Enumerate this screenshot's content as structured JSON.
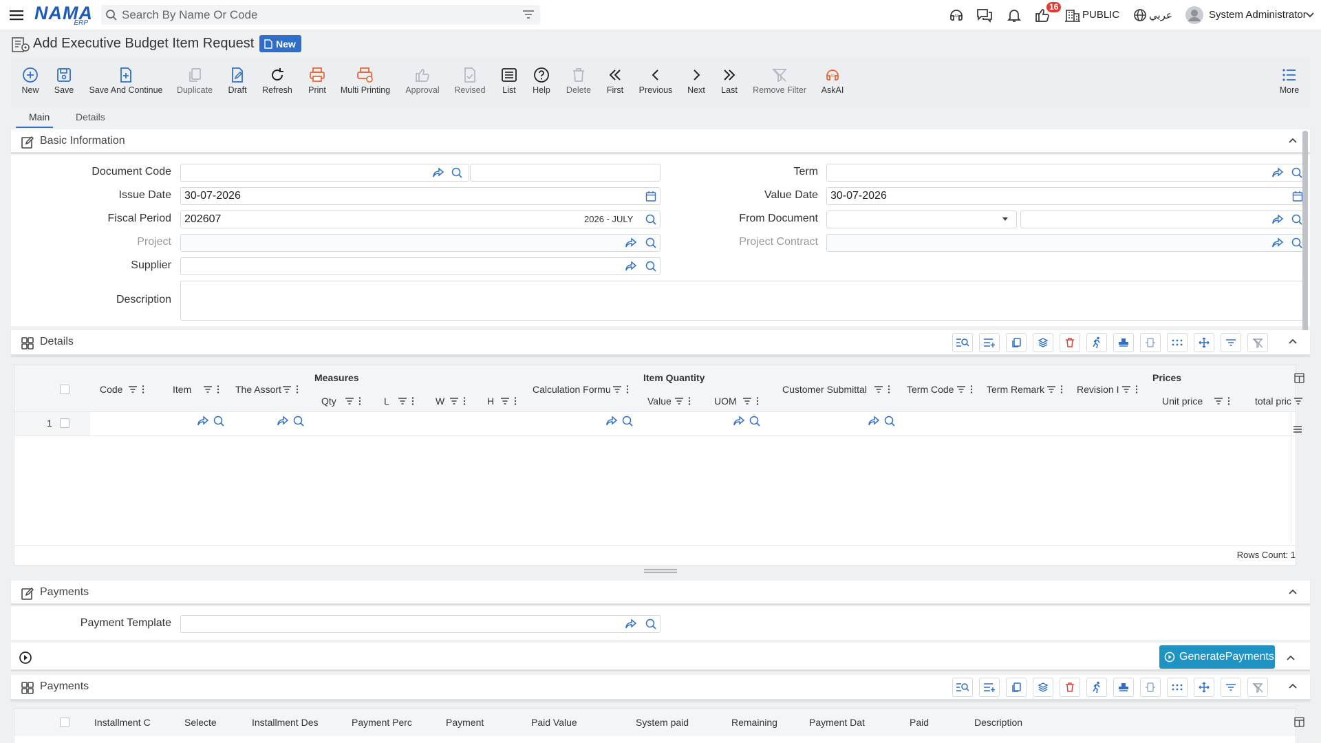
{
  "header": {
    "logo_main": "NAMA",
    "logo_sub": "ERP",
    "search_placeholder": "Search By Name Or Code",
    "notifications_count": "16",
    "company": "PUBLIC",
    "language": "عربي",
    "user": "System Administrator"
  },
  "page": {
    "title": "Add Executive Budget Item Request",
    "status": "New"
  },
  "toolbar": {
    "items": [
      {
        "label": "New",
        "icon": "plus-circle-icon"
      },
      {
        "label": "Save",
        "icon": "save-icon"
      },
      {
        "label": "Save And Continue",
        "icon": "save-continue-icon"
      },
      {
        "label": "Duplicate",
        "icon": "duplicate-icon"
      },
      {
        "label": "Draft",
        "icon": "draft-icon"
      },
      {
        "label": "Refresh",
        "icon": "refresh-icon"
      },
      {
        "label": "Print",
        "icon": "print-icon"
      },
      {
        "label": "Multi Printing",
        "icon": "multi-print-icon"
      },
      {
        "label": "Approval",
        "icon": "approval-icon"
      },
      {
        "label": "Revised",
        "icon": "revised-icon"
      },
      {
        "label": "List",
        "icon": "list-icon"
      },
      {
        "label": "Help",
        "icon": "help-icon"
      },
      {
        "label": "Delete",
        "icon": "delete-icon"
      },
      {
        "label": "First",
        "icon": "first-icon"
      },
      {
        "label": "Previous",
        "icon": "previous-icon"
      },
      {
        "label": "Next",
        "icon": "next-icon"
      },
      {
        "label": "Last",
        "icon": "last-icon"
      },
      {
        "label": "Remove Filter",
        "icon": "remove-filter-icon"
      },
      {
        "label": "AskAI",
        "icon": "askai-icon"
      },
      {
        "label": "More",
        "icon": "more-icon"
      }
    ]
  },
  "tabs": [
    {
      "label": "Main"
    },
    {
      "label": "Details"
    }
  ],
  "basic_info": {
    "title": "Basic Information",
    "document_code": {
      "label": "Document Code",
      "value": ""
    },
    "issue_date": {
      "label": "Issue Date",
      "value": "30-07-2026"
    },
    "fiscal_period": {
      "label": "Fiscal Period",
      "value": "202607",
      "hint": "2026 - JULY"
    },
    "project": {
      "label": "Project",
      "value": ""
    },
    "supplier": {
      "label": "Supplier",
      "value": ""
    },
    "description": {
      "label": "Description",
      "value": ""
    },
    "term": {
      "label": "Term",
      "value": ""
    },
    "value_date": {
      "label": "Value Date",
      "value": "30-07-2026"
    },
    "from_document": {
      "label": "From Document",
      "value": ""
    },
    "project_contract": {
      "label": "Project Contract",
      "value": ""
    }
  },
  "details_grid": {
    "title": "Details",
    "groups": {
      "measures": "Measures",
      "item_quantity": "Item Quantity",
      "prices": "Prices"
    },
    "columns": {
      "code": "Code",
      "item": "Item",
      "assortment": "The Assort",
      "qty": "Qty",
      "l": "L",
      "w": "W",
      "h": "H",
      "calc_formula": "Calculation Formu",
      "value": "Value",
      "uom": "UOM",
      "customer_submittal": "Customer Submittal",
      "term_code": "Term Code",
      "term_remark": "Term Remark",
      "revision": "Revision I",
      "unit_price": "Unit price",
      "total_price": "total pric"
    },
    "rows": [
      {
        "index": "1"
      }
    ],
    "rows_count": "Rows Count: 1"
  },
  "payments_section": {
    "title": "Payments",
    "payment_template": {
      "label": "Payment Template",
      "value": ""
    },
    "generate_button": "GeneratePayments"
  },
  "payments_grid": {
    "title": "Payments",
    "columns": {
      "installment_code": "Installment C",
      "selected": "Selecte",
      "installment_desc": "Installment Des",
      "payment_percent": "Payment Perc",
      "payment": "Payment",
      "paid_value": "Paid Value",
      "system_paid": "System paid",
      "remaining": "Remaining",
      "payment_date": "Payment Dat",
      "paid": "Paid",
      "description": "Description"
    }
  },
  "colors": {
    "accent": "#2f6fc9",
    "generate": "#1f93c4",
    "print": "#e8622c",
    "delete_red": "#d9463b"
  }
}
